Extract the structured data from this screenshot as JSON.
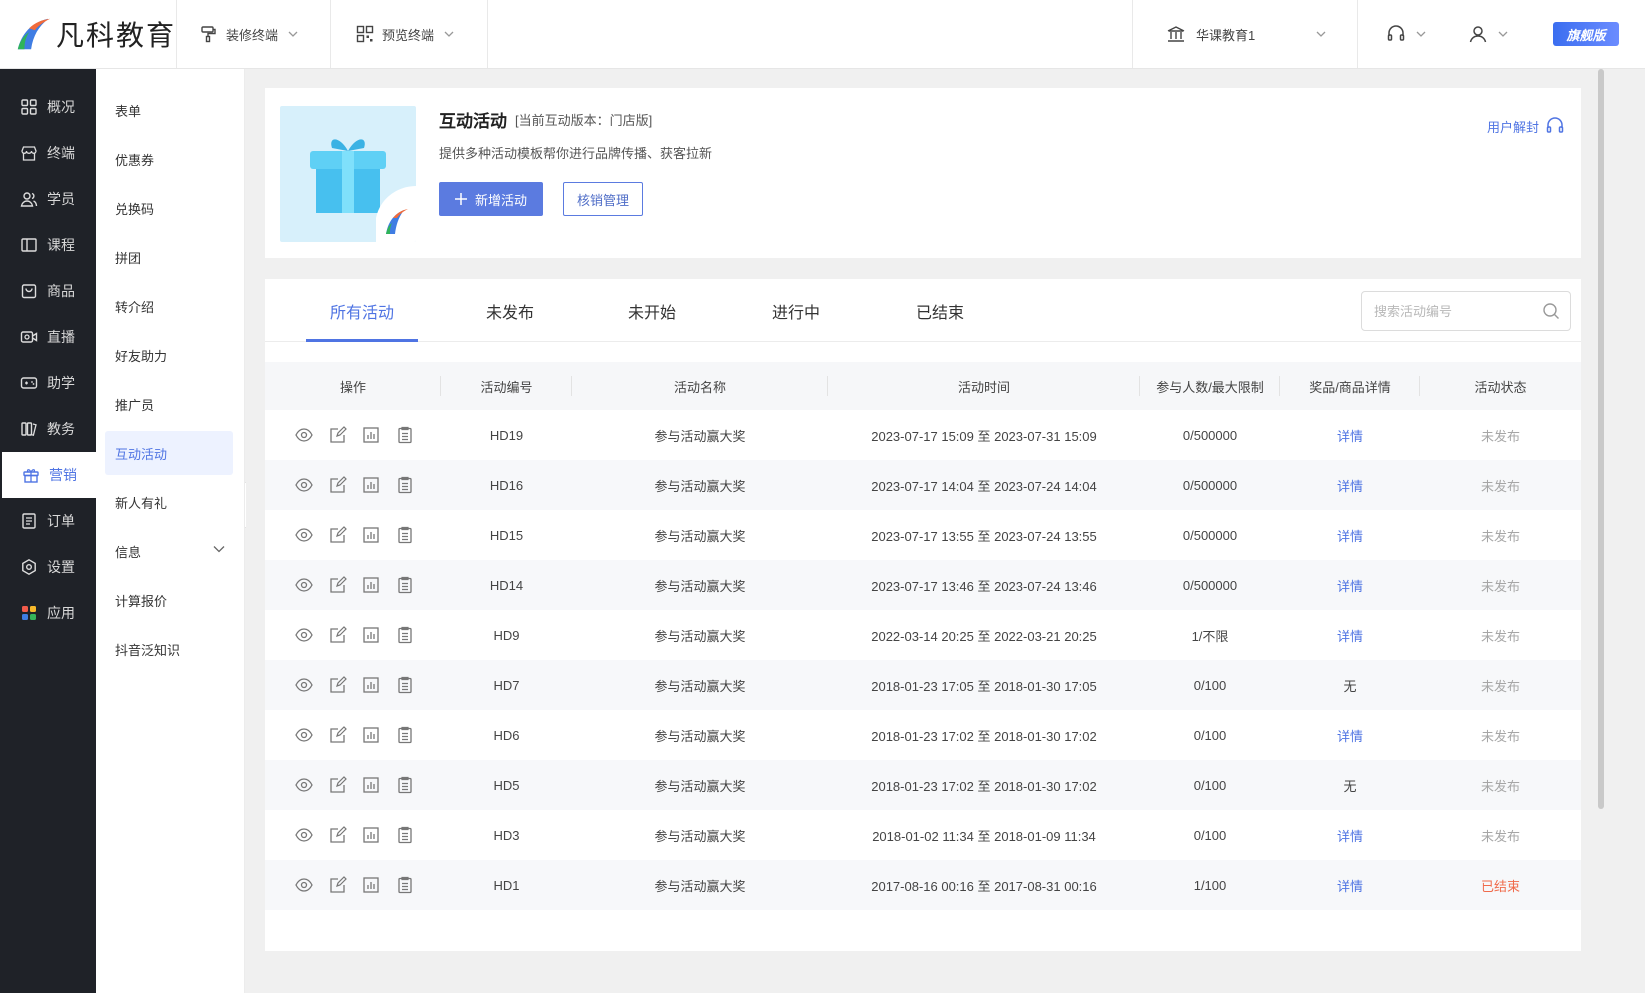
{
  "brand": {
    "name": "凡科教育"
  },
  "topbar": {
    "decorate_label": "装修终端",
    "preview_label": "预览终端",
    "account_label": "华课教育1",
    "edition_badge": "旗舰版"
  },
  "nav": {
    "items": [
      {
        "label": "概况",
        "icon": "grid-icon"
      },
      {
        "label": "终端",
        "icon": "store-icon"
      },
      {
        "label": "学员",
        "icon": "users-icon"
      },
      {
        "label": "课程",
        "icon": "book-icon"
      },
      {
        "label": "商品",
        "icon": "bag-icon"
      },
      {
        "label": "直播",
        "icon": "camera-icon"
      },
      {
        "label": "助学",
        "icon": "gamepad-icon"
      },
      {
        "label": "教务",
        "icon": "books-icon"
      },
      {
        "label": "营销",
        "icon": "gift-icon",
        "active": true
      },
      {
        "label": "订单",
        "icon": "order-icon"
      },
      {
        "label": "设置",
        "icon": "gear-icon"
      },
      {
        "label": "应用",
        "icon": "apps-icon"
      }
    ]
  },
  "submenu": {
    "items": [
      {
        "label": "表单"
      },
      {
        "label": "优惠券"
      },
      {
        "label": "兑换码"
      },
      {
        "label": "拼团"
      },
      {
        "label": "转介绍"
      },
      {
        "label": "好友助力"
      },
      {
        "label": "推广员"
      },
      {
        "label": "互动活动",
        "active": true
      },
      {
        "label": "新人有礼"
      },
      {
        "label": "信息"
      },
      {
        "label": "计算报价"
      },
      {
        "label": "抖音泛知识"
      }
    ]
  },
  "header": {
    "title": "互动活动",
    "version": "[当前互动版本：门店版]",
    "description": "提供多种活动模板帮你进行品牌传播、获客拉新",
    "add_button": "新增活动",
    "verify_button": "核销管理",
    "help_link": "用户解封"
  },
  "tabs": [
    "所有活动",
    "未发布",
    "未开始",
    "进行中",
    "已结束"
  ],
  "search": {
    "placeholder": "搜索活动编号"
  },
  "table": {
    "columns": [
      "操作",
      "活动编号",
      "活动名称",
      "活动时间",
      "参与人数/最大限制",
      "奖品/商品详情",
      "活动状态"
    ],
    "rows": [
      {
        "id": "HD19",
        "name": "参与活动赢大奖",
        "time": "2023-07-17 15:09 至 2023-07-31 15:09",
        "limit": "0/500000",
        "detail": "详情",
        "status": "未发布"
      },
      {
        "id": "HD16",
        "name": "参与活动赢大奖",
        "time": "2023-07-17 14:04 至 2023-07-24 14:04",
        "limit": "0/500000",
        "detail": "详情",
        "status": "未发布"
      },
      {
        "id": "HD15",
        "name": "参与活动赢大奖",
        "time": "2023-07-17 13:55 至 2023-07-24 13:55",
        "limit": "0/500000",
        "detail": "详情",
        "status": "未发布"
      },
      {
        "id": "HD14",
        "name": "参与活动赢大奖",
        "time": "2023-07-17 13:46 至 2023-07-24 13:46",
        "limit": "0/500000",
        "detail": "详情",
        "status": "未发布"
      },
      {
        "id": "HD9",
        "name": "参与活动赢大奖",
        "time": "2022-03-14 20:25 至 2022-03-21 20:25",
        "limit": "1/不限",
        "detail": "详情",
        "status": "未发布"
      },
      {
        "id": "HD7",
        "name": "参与活动赢大奖",
        "time": "2018-01-23 17:05 至 2018-01-30 17:05",
        "limit": "0/100",
        "detail": "无",
        "status": "未发布"
      },
      {
        "id": "HD6",
        "name": "参与活动赢大奖",
        "time": "2018-01-23 17:02 至 2018-01-30 17:02",
        "limit": "0/100",
        "detail": "详情",
        "status": "未发布"
      },
      {
        "id": "HD5",
        "name": "参与活动赢大奖",
        "time": "2018-01-23 17:02 至 2018-01-30 17:02",
        "limit": "0/100",
        "detail": "无",
        "status": "未发布"
      },
      {
        "id": "HD3",
        "name": "参与活动赢大奖",
        "time": "2018-01-02 11:34 至 2018-01-09 11:34",
        "limit": "0/100",
        "detail": "详情",
        "status": "未发布"
      },
      {
        "id": "HD1",
        "name": "参与活动赢大奖",
        "time": "2017-08-16 00:16 至 2017-08-31 00:16",
        "limit": "1/100",
        "detail": "详情",
        "status": "已结束"
      }
    ]
  },
  "colors": {
    "accent": "#4f74e3",
    "nav_bg": "#1f2228",
    "ended": "#f06b4b"
  }
}
